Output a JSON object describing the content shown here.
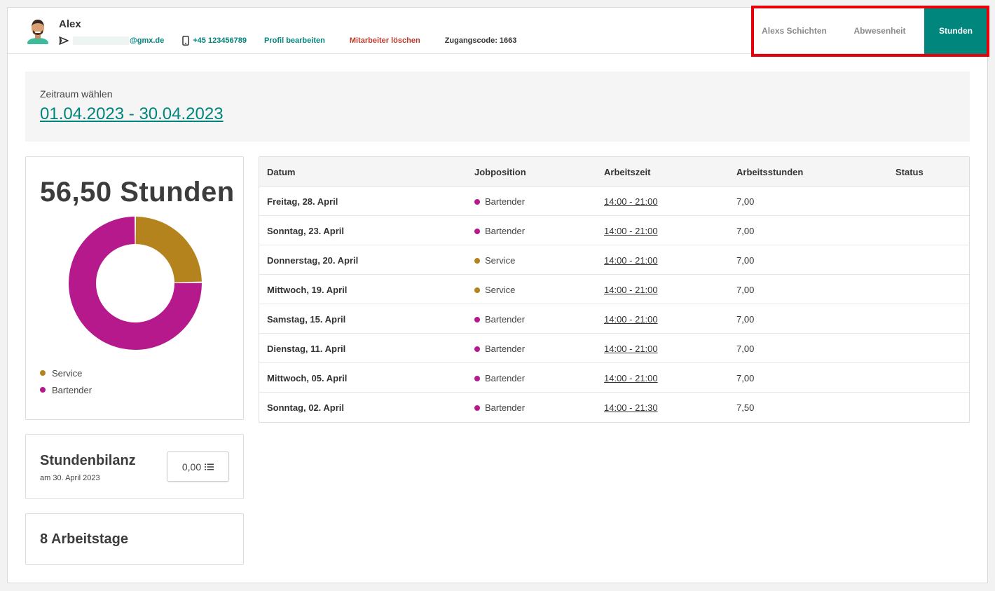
{
  "header": {
    "name": "Alex",
    "email_domain": "@gmx.de",
    "phone": "+45 123456789",
    "edit_profile": "Profil bearbeiten",
    "delete_employee": "Mitarbeiter löschen",
    "access_code": "Zugangscode: 1663",
    "tabs": [
      {
        "label": "Alexs Schichten",
        "active": false
      },
      {
        "label": "Abwesenheit",
        "active": false
      },
      {
        "label": "Stunden",
        "active": true
      }
    ]
  },
  "period": {
    "label": "Zeitraum wählen",
    "range": "01.04.2023 - 30.04.2023"
  },
  "summary": {
    "total_hours": "56,50 Stunden",
    "legend": [
      {
        "label": "Service",
        "color": "#b5831e"
      },
      {
        "label": "Bartender",
        "color": "#b5198c"
      }
    ]
  },
  "balance": {
    "title": "Stundenbilanz",
    "date": "am 30. April 2023",
    "value": "0,00"
  },
  "workdays": "8 Arbeitstage",
  "table": {
    "headers": [
      "Datum",
      "Jobposition",
      "Arbeitszeit",
      "Arbeitsstunden",
      "Status"
    ],
    "rows": [
      {
        "date": "Freitag, 28. April",
        "job": "Bartender",
        "job_color": "#b5198c",
        "time": "14:00 - 21:00",
        "hours": "7,00",
        "status": ""
      },
      {
        "date": "Sonntag, 23. April",
        "job": "Bartender",
        "job_color": "#b5198c",
        "time": "14:00 - 21:00",
        "hours": "7,00",
        "status": ""
      },
      {
        "date": "Donnerstag, 20. April",
        "job": "Service",
        "job_color": "#b5831e",
        "time": "14:00 - 21:00",
        "hours": "7,00",
        "status": ""
      },
      {
        "date": "Mittwoch, 19. April",
        "job": "Service",
        "job_color": "#b5831e",
        "time": "14:00 - 21:00",
        "hours": "7,00",
        "status": ""
      },
      {
        "date": "Samstag, 15. April",
        "job": "Bartender",
        "job_color": "#b5198c",
        "time": "14:00 - 21:00",
        "hours": "7,00",
        "status": ""
      },
      {
        "date": "Dienstag, 11. April",
        "job": "Bartender",
        "job_color": "#b5198c",
        "time": "14:00 - 21:00",
        "hours": "7,00",
        "status": ""
      },
      {
        "date": "Mittwoch, 05. April",
        "job": "Bartender",
        "job_color": "#b5198c",
        "time": "14:00 - 21:00",
        "hours": "7,00",
        "status": ""
      },
      {
        "date": "Sonntag, 02. April",
        "job": "Bartender",
        "job_color": "#b5198c",
        "time": "14:00 - 21:30",
        "hours": "7,50",
        "status": ""
      }
    ]
  },
  "chart_data": {
    "type": "pie",
    "categories": [
      "Service",
      "Bartender"
    ],
    "values": [
      14.0,
      42.5
    ],
    "colors": [
      "#b5831e",
      "#b5198c"
    ]
  },
  "icons": {
    "email": "send-icon",
    "phone": "phone-icon",
    "balance": "list-icon"
  }
}
